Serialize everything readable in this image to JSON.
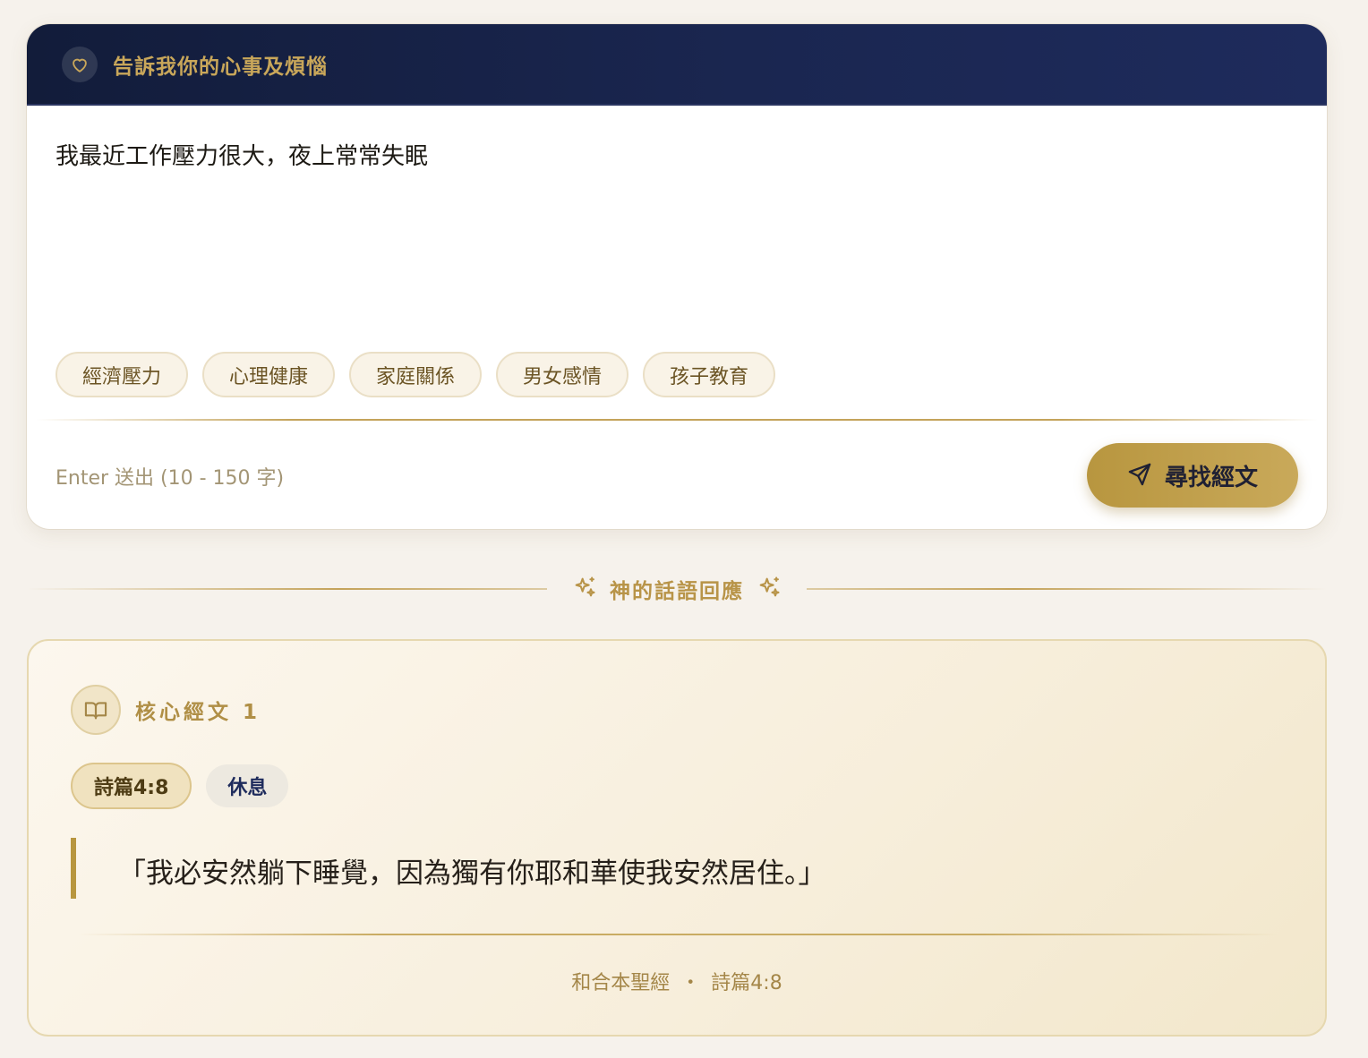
{
  "header": {
    "title": "告訴我你的心事及煩惱",
    "icon": "heart-icon"
  },
  "input": {
    "value": "我最近工作壓力很大，夜上常常失眠",
    "placeholder": ""
  },
  "tags": [
    {
      "label": "經濟壓力"
    },
    {
      "label": "心理健康"
    },
    {
      "label": "家庭關係"
    },
    {
      "label": "男女感情"
    },
    {
      "label": "孩子教育"
    }
  ],
  "footer": {
    "hint": "Enter 送出 (10 - 150 字)",
    "button_label": "尋找經文",
    "button_icon": "send-icon"
  },
  "section": {
    "title": "神的話語回應",
    "icon": "sparkles-icon"
  },
  "verse": {
    "core_title": "核心經文 1",
    "core_icon": "book-icon",
    "reference": "詩篇4:8",
    "theme": "休息",
    "text": "「我必安然躺下睡覺，因為獨有你耶和華使我安然居住。」",
    "source_book": "和合本聖經",
    "source_separator": "・",
    "source_reference": "詩篇4:8"
  },
  "colors": {
    "header_bg": "#1a2650",
    "gold": "#c4a35a",
    "background": "#f6f2ec"
  }
}
